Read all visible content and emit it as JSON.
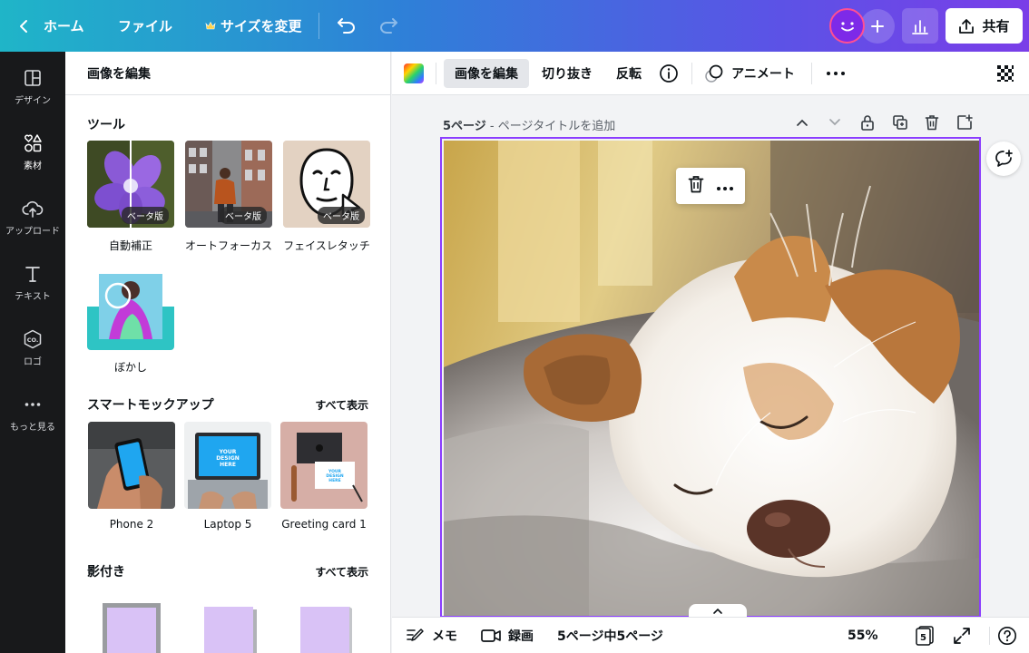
{
  "topbar": {
    "home_label": "ホーム",
    "file_label": "ファイル",
    "resize_label": "サイズを変更",
    "share_label": "共有"
  },
  "rail": {
    "items": [
      {
        "label": "デザイン",
        "icon": "layout-icon"
      },
      {
        "label": "素材",
        "icon": "shapes-icon"
      },
      {
        "label": "アップロード",
        "icon": "upload-cloud-icon"
      },
      {
        "label": "テキスト",
        "icon": "text-icon"
      },
      {
        "label": "ロゴ",
        "icon": "logo-icon"
      },
      {
        "label": "もっと見る",
        "icon": "more-dots-icon"
      }
    ]
  },
  "panel": {
    "title": "画像を編集",
    "tools_title": "ツール",
    "tools": [
      {
        "label": "自動補正",
        "badge": "ベータ版"
      },
      {
        "label": "オートフォーカス",
        "badge": "ベータ版"
      },
      {
        "label": "フェイスレタッチ",
        "badge": "ベータ版"
      },
      {
        "label": "ぼかし"
      }
    ],
    "mockups_title": "スマートモックアップ",
    "mockups_see_all": "すべて表示",
    "mockups": [
      {
        "label": "Phone 2"
      },
      {
        "label": "Laptop 5",
        "screen_text": "YOUR DESIGN HERE"
      },
      {
        "label": "Greeting card 1",
        "screen_text": "YOUR DESIGN HERE"
      }
    ],
    "shadows_title": "影付き",
    "shadows_see_all": "すべて表示"
  },
  "toolbar": {
    "edit_image": "画像を編集",
    "crop": "切り抜き",
    "flip": "反転",
    "animate": "アニメート"
  },
  "page": {
    "number_label": "5ページ",
    "title_placeholder": " - ページタイトルを追加"
  },
  "bottombar": {
    "notes": "メモ",
    "record": "録画",
    "page_counter": "5ページ中5ページ",
    "zoom": "55%",
    "pages_count": "5"
  },
  "colors": {
    "accent": "#8b3dff",
    "rail_bg": "#18191b",
    "topbar_start": "#1fb5c8",
    "topbar_end": "#7a3ee8"
  }
}
